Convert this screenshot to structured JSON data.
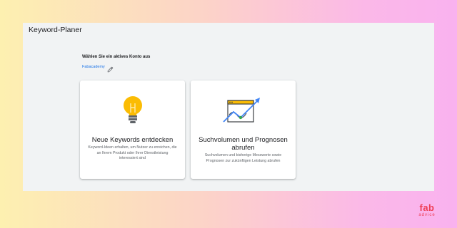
{
  "app": {
    "title": "Keyword-Planer"
  },
  "account": {
    "heading": "Wählen Sie ein aktives Konto aus",
    "name": "Fabacademy",
    "edit_icon": "pencil-icon"
  },
  "cards": [
    {
      "icon": "lightbulb-icon",
      "title": "Neue Keywords entdecken",
      "description": "Keyword-Ideen erhalten, um Nutzer zu erreichen, die an Ihrem Produkt oder Ihrer Dienstleistung interessiert sind"
    },
    {
      "icon": "trend-chart-icon",
      "title": "Suchvolumen und Prognosen abrufen",
      "description": "Suchvolumen und bisherige Messwerte sowie Prognosen zur zukünftigen Leistung abrufen"
    }
  ],
  "brand": {
    "line1": "fab",
    "line2": "advice",
    "color": "#ef3e56"
  },
  "colors": {
    "accent": "#1a73e8",
    "bulb": "#fbbc04",
    "chart_line": "#34a853"
  }
}
